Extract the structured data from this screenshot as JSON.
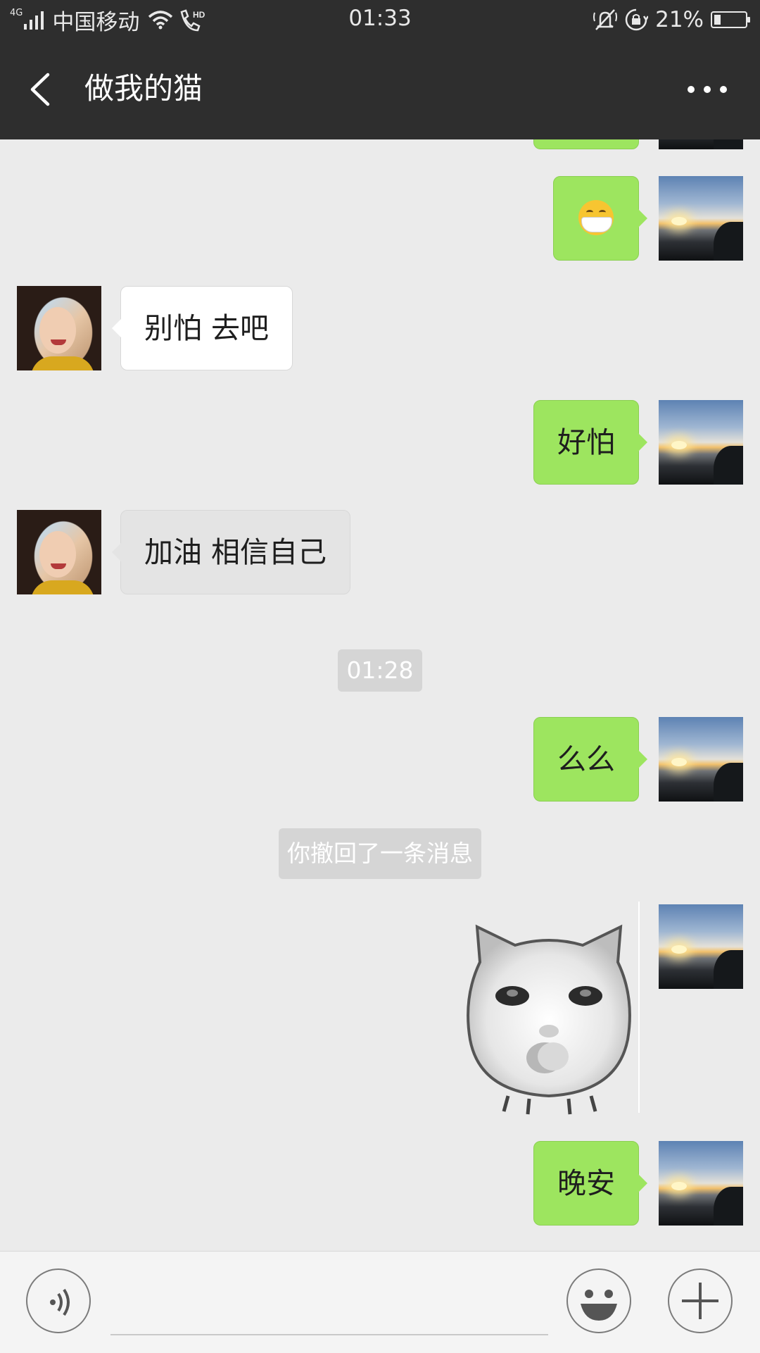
{
  "status_bar": {
    "network": "4G",
    "carrier": "中国移动",
    "hd": "HD",
    "time": "01:33",
    "battery_percent_text": "21%",
    "battery_level": 0.21,
    "icons": [
      "signal-icon",
      "wifi-icon",
      "hd-call-icon",
      "mute-icon",
      "rotation-lock-icon",
      "battery-icon"
    ]
  },
  "nav": {
    "back_icon": "back-chevron-icon",
    "title": "做我的猫",
    "more_icon": "more-dots-icon"
  },
  "messages": [
    {
      "sender": "me",
      "type": "text",
      "text": "",
      "partial": true
    },
    {
      "sender": "me",
      "type": "emoji",
      "emoji": "mask-face-emoji"
    },
    {
      "sender": "her",
      "type": "text",
      "text": "别怕 去吧"
    },
    {
      "sender": "me",
      "type": "text",
      "text": "好怕"
    },
    {
      "sender": "her",
      "type": "text",
      "text": "加油 相信自己"
    },
    {
      "type": "timestamp",
      "text": "01:28"
    },
    {
      "sender": "me",
      "type": "text",
      "text": "么么"
    },
    {
      "type": "system",
      "text": "你撤回了一条消息"
    },
    {
      "sender": "me",
      "type": "sticker",
      "sticker": "kissing-baby-cat-sticker"
    },
    {
      "sender": "me",
      "type": "text",
      "text": "晚安"
    }
  ],
  "input_bar": {
    "voice_icon": "voice-input-icon",
    "emoji_icon": "emoji-icon",
    "plus_icon": "plus-icon",
    "text_value": ""
  }
}
